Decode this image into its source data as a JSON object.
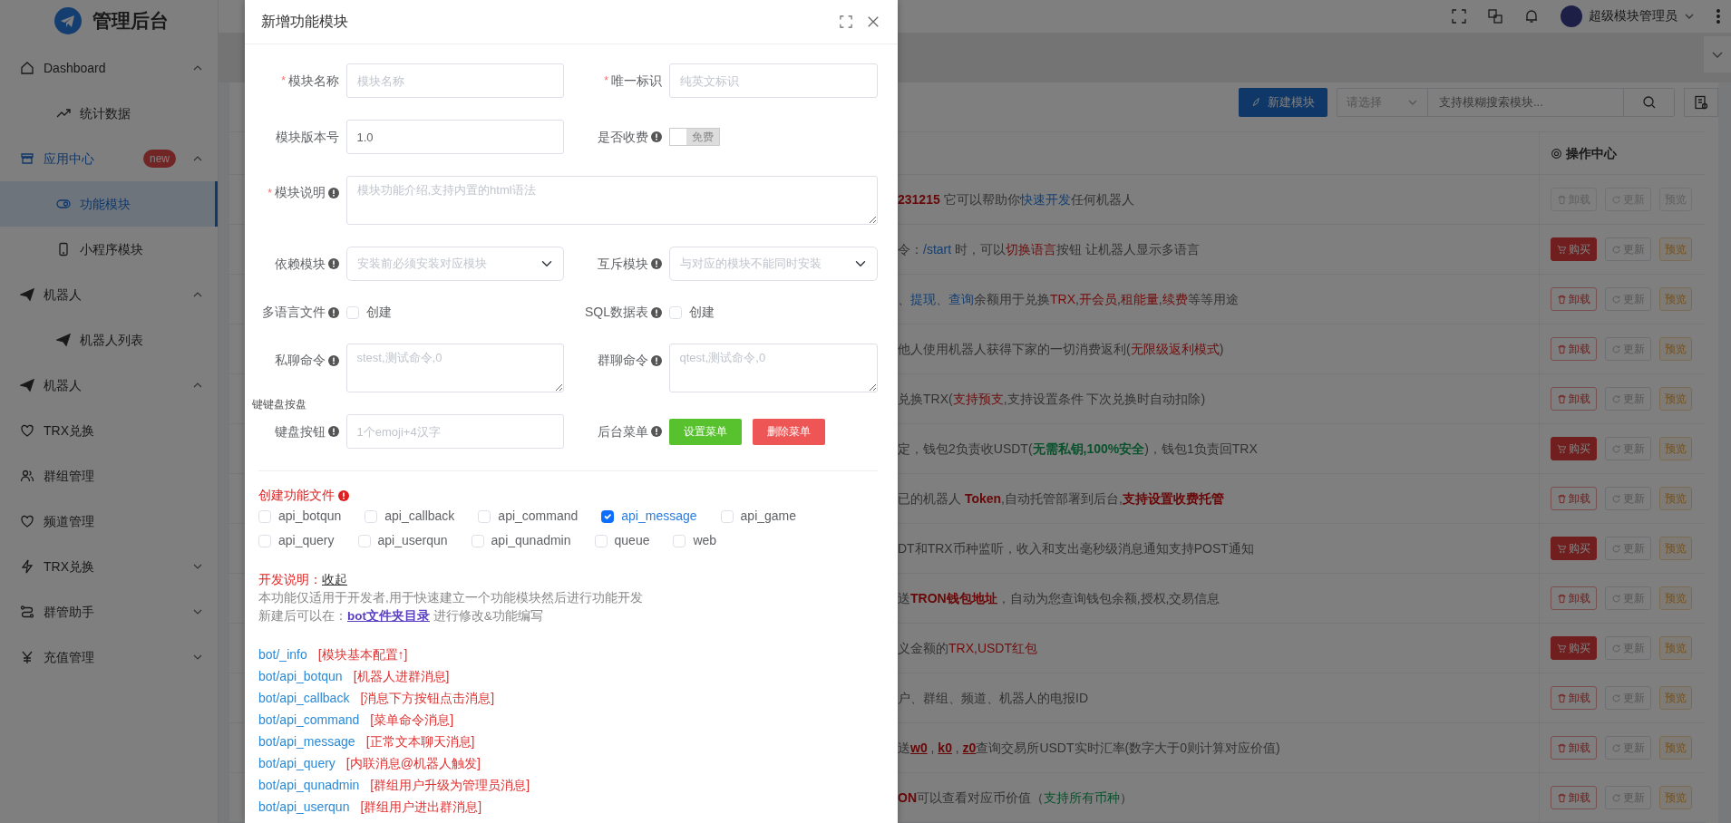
{
  "sidebar": {
    "logo_text": "管理后台",
    "items": [
      {
        "label": "Dashboard",
        "expanded": true,
        "selected": false,
        "children": [
          {
            "label": "统计数据",
            "selected": false
          }
        ]
      },
      {
        "label": "应用中心",
        "expanded": true,
        "selected": true,
        "badge": "new",
        "children": [
          {
            "label": "功能模块",
            "selected": true
          },
          {
            "label": "小程序模块",
            "selected": false
          }
        ]
      },
      {
        "label": "机器人",
        "expanded": true,
        "selected": false,
        "children": [
          {
            "label": "机器人列表",
            "selected": false
          }
        ]
      },
      {
        "label": "机器人",
        "expanded": true,
        "selected": false
      },
      {
        "label": "TRX兑换",
        "selected": false
      },
      {
        "label": "群组管理",
        "selected": false
      },
      {
        "label": "频道管理",
        "selected": false
      },
      {
        "label": "TRX兑换",
        "expanded": false,
        "selected": false
      },
      {
        "label": "群管助手",
        "expanded": false,
        "selected": false
      },
      {
        "label": "充值管理",
        "expanded": false,
        "selected": false
      }
    ]
  },
  "header": {
    "user_name": "超级模块管理员"
  },
  "toolbar": {
    "new_button": "新建模块",
    "filter_placeholder": "请选择",
    "search_placeholder": "支持模糊搜索模块..."
  },
  "table": {
    "ops_heading": "操作中心",
    "rows": [
      {
        "disabled": true,
        "action": {
          "kind": "uninstall",
          "label": "卸载"
        },
        "update": "更新",
        "preview": "预览",
        "description": [
          {
            "kind": "redbold",
            "text": "231215"
          },
          {
            "kind": "plain",
            "text": " 它可以帮助你"
          },
          {
            "kind": "blue",
            "text": "快速开发"
          },
          {
            "kind": "plain",
            "text": "任何机器人"
          }
        ]
      },
      {
        "disabled": false,
        "action": {
          "kind": "buy",
          "label": "购买"
        },
        "update": "更新",
        "preview": "预览",
        "description": [
          {
            "kind": "plain",
            "text": "令："
          },
          {
            "kind": "blue",
            "text": "/start"
          },
          {
            "kind": "plain",
            "text": " 时，可以"
          },
          {
            "kind": "red",
            "text": "切换语言"
          },
          {
            "kind": "plain",
            "text": "按钮 让机器人显示多语言"
          }
        ]
      },
      {
        "disabled": false,
        "action": {
          "kind": "uninstall",
          "label": "卸载"
        },
        "update": "更新",
        "preview": "预览",
        "description": [
          {
            "kind": "plain",
            "text": "、"
          },
          {
            "kind": "blue",
            "text": "提现"
          },
          {
            "kind": "plain",
            "text": "、"
          },
          {
            "kind": "blue",
            "text": "查询"
          },
          {
            "kind": "plain",
            "text": "余额用于兑换"
          },
          {
            "kind": "red",
            "text": "TRX"
          },
          {
            "kind": "plain",
            "text": ","
          },
          {
            "kind": "red",
            "text": "开会员"
          },
          {
            "kind": "plain",
            "text": ","
          },
          {
            "kind": "red",
            "text": "租能量"
          },
          {
            "kind": "plain",
            "text": ","
          },
          {
            "kind": "red",
            "text": "续费"
          },
          {
            "kind": "plain",
            "text": "等等用途"
          }
        ]
      },
      {
        "disabled": false,
        "action": {
          "kind": "uninstall",
          "label": "卸载"
        },
        "update": "更新",
        "preview": "预览",
        "description": [
          {
            "kind": "plain",
            "text": "他人使用机器人获得下家的一切消费返利("
          },
          {
            "kind": "red",
            "text": "无限级返利模式"
          },
          {
            "kind": "plain",
            "text": ")"
          }
        ]
      },
      {
        "disabled": false,
        "action": {
          "kind": "uninstall",
          "label": "卸载"
        },
        "update": "更新",
        "preview": "预览",
        "description": [
          {
            "kind": "plain",
            "text": "兑换TRX("
          },
          {
            "kind": "red",
            "text": "支持预支"
          },
          {
            "kind": "plain",
            "text": ",支持设置条件 下次兑换时自动扣除)"
          }
        ]
      },
      {
        "disabled": false,
        "action": {
          "kind": "buy",
          "label": "购买"
        },
        "update": "更新",
        "preview": "预览",
        "description": [
          {
            "kind": "plain",
            "text": "定，钱包2负责收USDT("
          },
          {
            "kind": "greenbold",
            "text": "无需私钥,100%安全"
          },
          {
            "kind": "plain",
            "text": ")，钱包1负责回TRX"
          }
        ]
      },
      {
        "disabled": false,
        "action": {
          "kind": "uninstall",
          "label": "卸载"
        },
        "update": "更新",
        "preview": "预览",
        "description": [
          {
            "kind": "plain",
            "text": "已的机器人 "
          },
          {
            "kind": "redbold",
            "text": "Token"
          },
          {
            "kind": "plain",
            "text": ",自动托管部署到后台,"
          },
          {
            "kind": "redbold",
            "text": "支持设置收费托管"
          }
        ]
      },
      {
        "disabled": false,
        "action": {
          "kind": "buy",
          "label": "购买"
        },
        "update": "更新",
        "preview": "预览",
        "description": [
          {
            "kind": "plain",
            "text": "DT和TRX币种监听，收入和支出毫秒级消息通知支持POST通知"
          }
        ]
      },
      {
        "disabled": false,
        "action": {
          "kind": "uninstall",
          "label": "卸载"
        },
        "update": "更新",
        "preview": "预览",
        "description": [
          {
            "kind": "plain",
            "text": "送"
          },
          {
            "kind": "redbold",
            "text": "TRON钱包地址"
          },
          {
            "kind": "plain",
            "text": "，自动为您查询钱包余额,授权,交易信息"
          }
        ]
      },
      {
        "disabled": false,
        "action": {
          "kind": "buy",
          "label": "购买"
        },
        "update": "更新",
        "preview": "预览",
        "description": [
          {
            "kind": "plain",
            "text": "义金额的"
          },
          {
            "kind": "red",
            "text": "TRX,USDT红包"
          }
        ]
      },
      {
        "disabled": false,
        "action": {
          "kind": "uninstall",
          "label": "卸载"
        },
        "update": "更新",
        "preview": "预览",
        "description": [
          {
            "kind": "plain",
            "text": "户、群组、频道、机器人的电报ID"
          }
        ]
      },
      {
        "disabled": false,
        "action": {
          "kind": "uninstall",
          "label": "卸载"
        },
        "update": "更新",
        "preview": "预览",
        "description": [
          {
            "kind": "plain",
            "text": "送"
          },
          {
            "kind": "redlink",
            "text": "w0"
          },
          {
            "kind": "plain",
            "text": " , "
          },
          {
            "kind": "redlink",
            "text": "k0"
          },
          {
            "kind": "plain",
            "text": " , "
          },
          {
            "kind": "redlink",
            "text": "z0"
          },
          {
            "kind": "plain",
            "text": "查询交易所USDT实时汇率(数字大于0则计算对应价值)"
          }
        ]
      },
      {
        "disabled": false,
        "action": {
          "kind": "uninstall",
          "label": "卸载"
        },
        "update": "更新",
        "preview": "预览",
        "description": [
          {
            "kind": "redbold",
            "text": "ON"
          },
          {
            "kind": "plain",
            "text": "可以查看对应币价值（"
          },
          {
            "kind": "green",
            "text": "支持所有币种"
          },
          {
            "kind": "plain",
            "text": "）"
          }
        ]
      }
    ]
  },
  "modal": {
    "title": "新增功能模块",
    "required_mark": "*",
    "form": [
      {
        "kind": "pair",
        "fields": [
          {
            "kind": "input",
            "label": "模块名称",
            "required": true,
            "info": false,
            "placeholder": "模块名称"
          },
          {
            "kind": "input",
            "label": "唯一标识",
            "required": true,
            "info": false,
            "placeholder": "纯英文标识"
          }
        ]
      },
      {
        "kind": "pair",
        "fields": [
          {
            "kind": "input",
            "label": "模块版本号",
            "required": false,
            "info": false,
            "value": "1.0"
          },
          {
            "kind": "switch",
            "label": "是否收费",
            "required": false,
            "info": true,
            "on": false,
            "text": "免费"
          }
        ]
      },
      {
        "kind": "full",
        "fields": [
          {
            "kind": "textarea",
            "label": "模块说明",
            "required": true,
            "info": true,
            "placeholder": "模块功能介绍,支持内置的html语法"
          }
        ]
      },
      {
        "kind": "pair",
        "fields": [
          {
            "kind": "select",
            "label": "依赖模块",
            "required": false,
            "info": true,
            "placeholder": "安装前必须安装对应模块"
          },
          {
            "kind": "select",
            "label": "互斥模块",
            "required": false,
            "info": true,
            "placeholder": "与对应的模块不能同时安装"
          }
        ]
      },
      {
        "kind": "pair",
        "fields": [
          {
            "kind": "checkbox",
            "label": "多语言文件",
            "required": false,
            "info": true,
            "checked": false,
            "text": "创建"
          },
          {
            "kind": "checkbox",
            "label": "SQL数据表",
            "required": false,
            "info": true,
            "checked": false,
            "text": "创建"
          }
        ]
      },
      {
        "kind": "pair",
        "fields": [
          {
            "kind": "textarea",
            "label": "私聊命令",
            "required": false,
            "info": true,
            "placeholder": "stest,测试命令,0"
          },
          {
            "kind": "textarea",
            "label": "群聊命令",
            "required": false,
            "info": true,
            "placeholder": "qtest,测试命令,0"
          }
        ]
      },
      {
        "kind": "note",
        "text": "键键盘按盘"
      },
      {
        "kind": "pair",
        "fields": [
          {
            "kind": "input",
            "label": "键盘按钮",
            "required": false,
            "info": true,
            "placeholder": "1个emoji+4汉字"
          },
          {
            "kind": "buttons",
            "label": "后台菜单",
            "required": false,
            "info": true,
            "buttons": [
              {
                "kind": "success",
                "label": "设置菜单"
              },
              {
                "kind": "danger",
                "label": "删除菜单"
              }
            ]
          }
        ]
      }
    ],
    "files_heading": "创建功能文件",
    "files": [
      {
        "label": "api_botqun",
        "checked": false
      },
      {
        "label": "api_callback",
        "checked": false
      },
      {
        "label": "api_command",
        "checked": false
      },
      {
        "label": "api_message",
        "checked": true
      },
      {
        "label": "api_game",
        "checked": false
      },
      {
        "label": "api_query",
        "checked": false
      },
      {
        "label": "api_userqun",
        "checked": false
      },
      {
        "label": "api_qunadmin",
        "checked": false
      },
      {
        "label": "queue",
        "checked": false
      },
      {
        "label": "web",
        "checked": false
      }
    ],
    "dev_heading": "开发说明：",
    "dev_toggle": "收起",
    "dev_text": "本功能仅适用于开发者,用于快速建立一个功能模块然后进行功能开发",
    "dev_path_prefix": "新建后可以在：",
    "dev_path_link": "bot文件夹目录",
    "dev_path_suffix": " 进行修改&功能编写",
    "paths": [
      {
        "path": "bot/_info",
        "desc": "[模块基本配置↑]"
      },
      {
        "path": "bot/api_botqun",
        "desc": "[机器人进群消息]"
      },
      {
        "path": "bot/api_callback",
        "desc": "[消息下方按钮点击消息]"
      },
      {
        "path": "bot/api_command",
        "desc": "[菜单命令消息]"
      },
      {
        "path": "bot/api_message",
        "desc": "[正常文本聊天消息]"
      },
      {
        "path": "bot/api_query",
        "desc": "[内联消息@机器人触发]"
      },
      {
        "path": "bot/api_qunadmin",
        "desc": "[群组用户升级为管理员消息]"
      },
      {
        "path": "bot/api_userqun",
        "desc": "[群组用户进出群消息]"
      }
    ]
  }
}
